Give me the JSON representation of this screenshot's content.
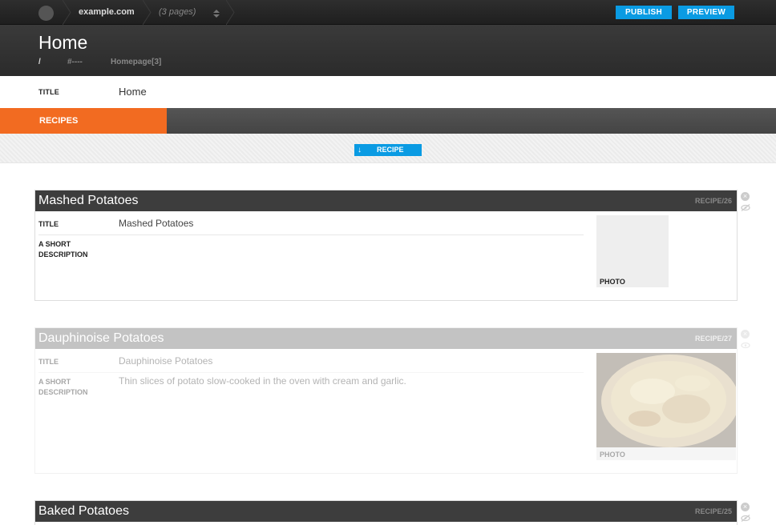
{
  "topbar": {
    "site": "example.com",
    "pages": "(3 pages)",
    "publish_label": "PUBLISH",
    "preview_label": "PREVIEW",
    "accent": "#0a9be3"
  },
  "page": {
    "title": "Home",
    "breadcrumb": [
      "/",
      "#----",
      "Homepage[3]"
    ]
  },
  "title_field": {
    "label": "TITLE",
    "value": "Home"
  },
  "tabs": {
    "active": "RECIPES",
    "active_color": "#f26b21"
  },
  "add_button": {
    "label": "RECIPE",
    "icon": "arrow-down-icon"
  },
  "recipes": [
    {
      "name": "Mashed Potatoes",
      "id": "RECIPE/26",
      "title_label": "TITLE",
      "title_value": "Mashed Potatoes",
      "desc_label_1": "A SHORT",
      "desc_label_2": "DESCRIPTION",
      "description": "",
      "photo_label": "PHOTO"
    },
    {
      "name": "Dauphinoise Potatoes",
      "id": "RECIPE/27",
      "title_label": "TITLE",
      "title_value": "Dauphinoise Potatoes",
      "desc_label_1": "A SHORT",
      "desc_label_2": "DESCRIPTION",
      "description": "Thin slices of potato slow-cooked in the oven with cream and garlic.",
      "photo_label": "PHOTO"
    },
    {
      "name": "Baked Potatoes",
      "id": "RECIPE/25"
    }
  ]
}
